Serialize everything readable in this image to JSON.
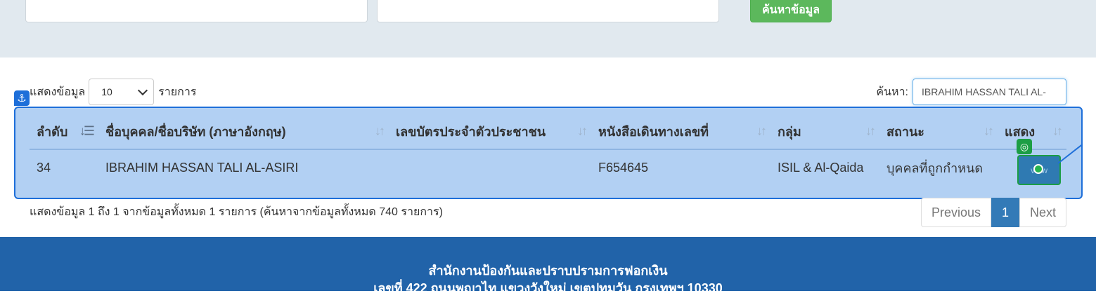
{
  "search_panel": {
    "button_label": "ค้นหาข้อมูล"
  },
  "length_control": {
    "prefix": "แสดงข้อมูล",
    "value": "10",
    "suffix": "รายการ"
  },
  "filter": {
    "label": "ค้นหา:",
    "value": "IBRAHIM HASSAN TALI AL-"
  },
  "table": {
    "columns": [
      "ลำดับ",
      "ชื่อบุคคล/ชื่อบริษัท (ภาษาอังกฤษ)",
      "เลขบัตรประจำตัวประชาชน",
      "หนังสือเดินทางเลขที่",
      "กลุ่ม",
      "สถานะ",
      "แสดง"
    ],
    "rows": [
      {
        "no": "34",
        "name": "IBRAHIM HASSAN TALI AL-ASIRI",
        "id_card": "",
        "passport": "F654645",
        "group": "ISIL & Al-Qaida",
        "status": "บุคคลที่ถูกกำหนด",
        "action": "view"
      }
    ]
  },
  "info_text": "แสดงข้อมูล 1 ถึง 1 จากข้อมูลทั้งหมด 1 รายการ (ค้นหาจากข้อมูลทั้งหมด 740 รายการ)",
  "pagination": {
    "previous": "Previous",
    "current": "1",
    "next": "Next"
  },
  "footer": {
    "line1": "สำนักงานป้องกันและปราบปรามการฟอกเงิน",
    "line2": "เลขที่ 422 ถนนพญาไท แขวงวังใหม่ เขตปทุมวัน กรุงเทพฯ 10330"
  },
  "colors": {
    "search_button": "#5cb85c",
    "highlight": "#b2d0f3",
    "highlight_border": "#1e6fd9",
    "footer": "#2163a9",
    "current_page": "#337ab7"
  },
  "icons": {
    "anchor": "anchor-icon",
    "target": "target-icon",
    "sort": "sort-icon",
    "chevron": "chevron-down-icon"
  }
}
